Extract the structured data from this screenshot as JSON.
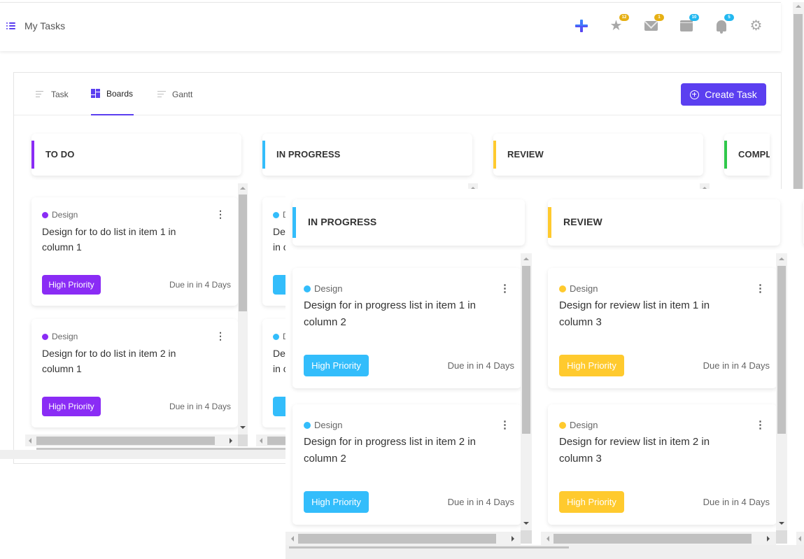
{
  "header": {
    "title": "My Tasks",
    "icons": [
      {
        "name": "add-icon",
        "badge": null
      },
      {
        "name": "star-icon",
        "badge": "12",
        "badge_color": "#e6b014"
      },
      {
        "name": "mail-icon",
        "badge": "1",
        "badge_color": "#e6b014"
      },
      {
        "name": "calendar-icon",
        "badge": "10",
        "badge_color": "#22b8f0"
      },
      {
        "name": "bell-icon",
        "badge": "5",
        "badge_color": "#22b8f0"
      },
      {
        "name": "gear-icon",
        "badge": null
      }
    ]
  },
  "tabs": [
    {
      "label": "Task",
      "active": false
    },
    {
      "label": "Boards",
      "active": true
    },
    {
      "label": "Gantt",
      "active": false
    }
  ],
  "create_button": "Create Task",
  "colors": {
    "accent": "#5b3ff0",
    "todo": "#8a2cf5",
    "in_progress": "#33bdfb",
    "review": "#ffca2e",
    "complete": "#2fc84a"
  },
  "columns": [
    {
      "title": "TO DO",
      "color": "#8a2cf5",
      "cards": [
        {
          "tag": "Design",
          "title": "Design for to do list in item 1 in column 1",
          "priority": "High Priority",
          "due": "Due in in 4 Days"
        },
        {
          "tag": "Design",
          "title": "Design for to do list in item 2 in column 1",
          "priority": "High Priority",
          "due": "Due in in 4 Days"
        }
      ]
    },
    {
      "title": "IN PROGRESS",
      "color": "#33bdfb",
      "cards": [
        {
          "tag": "Design",
          "title": "Design for in progress list in item 1 in column 2",
          "priority": "High Priority",
          "due": "Due in in 4 Days"
        },
        {
          "tag": "Design",
          "title": "Design for in progress list in item 2 in column 2",
          "priority": "High Priority",
          "due": "Due in in 4 Days"
        }
      ]
    },
    {
      "title": "REVIEW",
      "color": "#ffca2e",
      "cards": [
        {
          "tag": "Design",
          "title": "Design for review list in item 1 in column 3",
          "priority": "High Priority",
          "due": "Due in in 4 Days"
        },
        {
          "tag": "Design",
          "title": "Design for review list in item 2 in column 3",
          "priority": "High Priority",
          "due": "Due in in 4 Days"
        }
      ]
    },
    {
      "title": "COMPL",
      "color": "#2fc84a",
      "cards": []
    }
  ],
  "partial": {
    "in_progress_tag": "D",
    "in_progress_title_l1": "De",
    "in_progress_title_l2": "in c",
    "in_progress_prio": "H"
  }
}
